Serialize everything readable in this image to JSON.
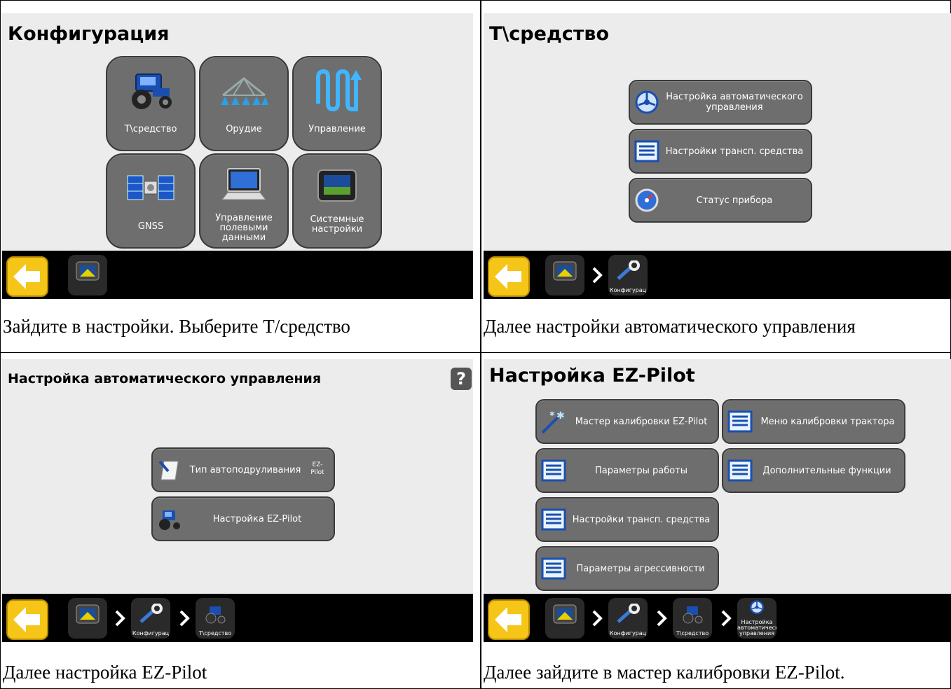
{
  "panels": {
    "config": {
      "title": "Конфигурация",
      "tiles": [
        {
          "label": "T\\средство",
          "icon": "tractor-icon"
        },
        {
          "label": "Орудие",
          "icon": "implement-boom-icon"
        },
        {
          "label": "Управление",
          "icon": "guidance-pattern-icon"
        },
        {
          "label": "GNSS",
          "icon": "satellite-icon"
        },
        {
          "label": "Управление полевыми данными",
          "icon": "laptop-icon"
        },
        {
          "label": "Системные настройки",
          "icon": "display-icon"
        }
      ],
      "caption": "Зайдите в настройки. Выберите Т/средство"
    },
    "vehicle": {
      "title": "T\\средство",
      "buttons": [
        {
          "label": "Настройка автоматического управления",
          "icon": "steering-wheel-icon"
        },
        {
          "label": "Настройки трансп. средства",
          "icon": "list-icon"
        },
        {
          "label": "Статус прибора",
          "icon": "gauge-icon"
        }
      ],
      "crumbs": [
        "Конфигурац"
      ],
      "caption": "Далее настройки автоматического управления"
    },
    "autosteer": {
      "title": "Настройка автоматического управления",
      "help": "?",
      "buttons": [
        {
          "label": "Тип автоподруливания",
          "badge": "EZ-Pilot",
          "icon": "pen-paper-icon"
        },
        {
          "label": "Настройка EZ-Pilot",
          "icon": "tractor-icon"
        }
      ],
      "crumbs": [
        "Конфигурац",
        "T\\средство"
      ],
      "caption": "Далее настройка EZ-Pilot"
    },
    "ezpilot": {
      "title": "Настройка EZ-Pilot",
      "buttons": [
        {
          "label": "Мастер калибровки EZ-Pilot",
          "icon": "wand-icon"
        },
        {
          "label": "Меню калибровки трактора",
          "icon": "list-icon"
        },
        {
          "label": "Параметры работы",
          "icon": "list-icon"
        },
        {
          "label": "Дополнительные функции",
          "icon": "list-icon"
        },
        {
          "label": "Настройки трансп. средства",
          "icon": "list-icon"
        },
        {
          "label": "Параметры агрессивности",
          "icon": "list-icon"
        }
      ],
      "crumbs": [
        "Конфигурац",
        "T\\средство",
        "Настройка автоматическ управления"
      ],
      "caption": "Далее зайдите в мастер калибровки EZ-Pilot."
    }
  },
  "colors": {
    "button": "#6e6e6e",
    "back": "#f5c518",
    "panel": "#ececec",
    "bar": "#000000"
  }
}
